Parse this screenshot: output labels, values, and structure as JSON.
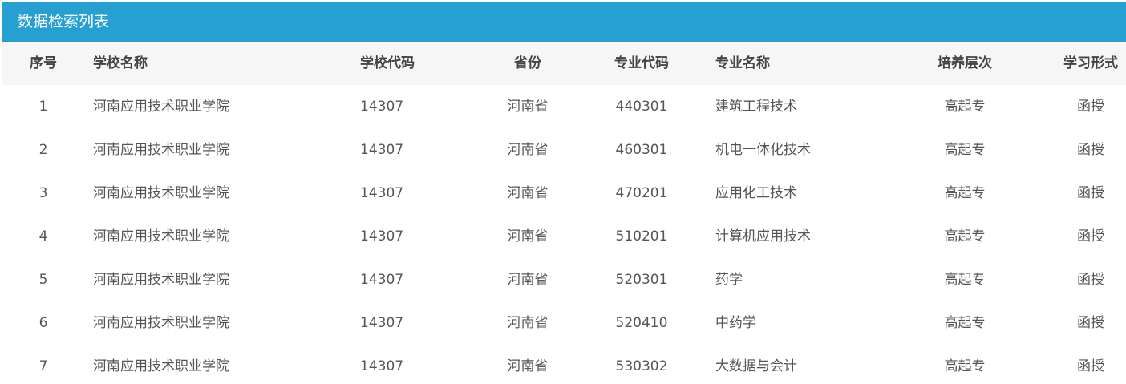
{
  "panel": {
    "title": "数据检索列表"
  },
  "table": {
    "headers": {
      "index": "序号",
      "school_name": "学校名称",
      "school_code": "学校代码",
      "province": "省份",
      "major_code": "专业代码",
      "major_name": "专业名称",
      "level": "培养层次",
      "study_mode": "学习形式"
    },
    "rows": [
      {
        "index": "1",
        "school_name": "河南应用技术职业学院",
        "school_code": "14307",
        "province": "河南省",
        "major_code": "440301",
        "major_name": "建筑工程技术",
        "level": "高起专",
        "study_mode": "函授"
      },
      {
        "index": "2",
        "school_name": "河南应用技术职业学院",
        "school_code": "14307",
        "province": "河南省",
        "major_code": "460301",
        "major_name": "机电一体化技术",
        "level": "高起专",
        "study_mode": "函授"
      },
      {
        "index": "3",
        "school_name": "河南应用技术职业学院",
        "school_code": "14307",
        "province": "河南省",
        "major_code": "470201",
        "major_name": "应用化工技术",
        "level": "高起专",
        "study_mode": "函授"
      },
      {
        "index": "4",
        "school_name": "河南应用技术职业学院",
        "school_code": "14307",
        "province": "河南省",
        "major_code": "510201",
        "major_name": "计算机应用技术",
        "level": "高起专",
        "study_mode": "函授"
      },
      {
        "index": "5",
        "school_name": "河南应用技术职业学院",
        "school_code": "14307",
        "province": "河南省",
        "major_code": "520301",
        "major_name": "药学",
        "level": "高起专",
        "study_mode": "函授"
      },
      {
        "index": "6",
        "school_name": "河南应用技术职业学院",
        "school_code": "14307",
        "province": "河南省",
        "major_code": "520410",
        "major_name": "中药学",
        "level": "高起专",
        "study_mode": "函授"
      },
      {
        "index": "7",
        "school_name": "河南应用技术职业学院",
        "school_code": "14307",
        "province": "河南省",
        "major_code": "530302",
        "major_name": "大数据与会计",
        "level": "高起专",
        "study_mode": "函授"
      }
    ]
  },
  "colors": {
    "header_bar": "#26a0d2",
    "header_text": "#ffffff",
    "table_head_bg": "#f6f6f6",
    "text": "#555555"
  }
}
